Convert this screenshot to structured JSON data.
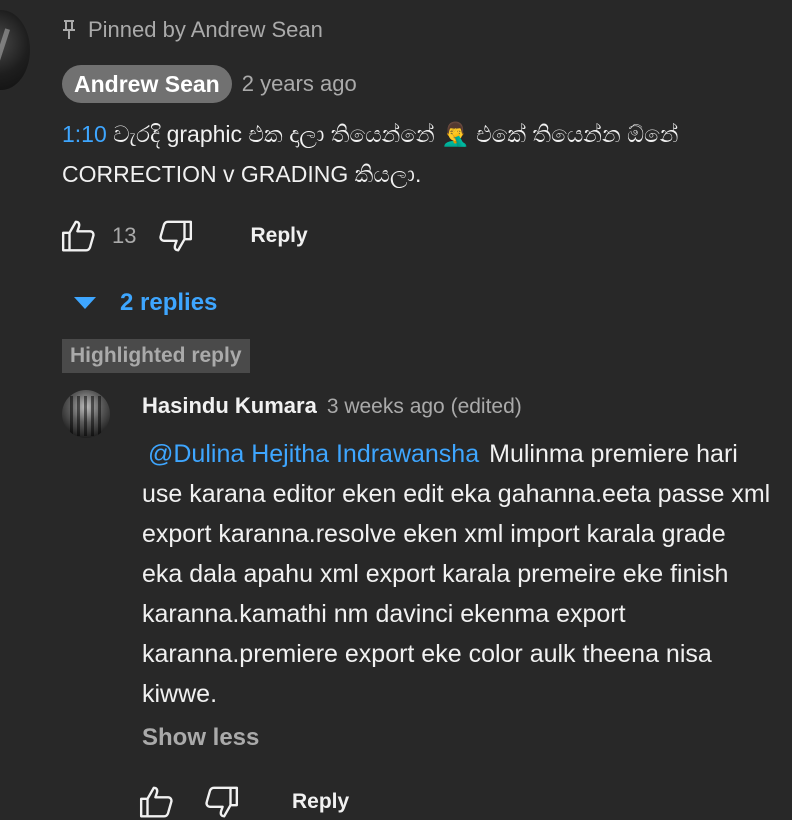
{
  "pinned": {
    "text": "Pinned by Andrew Sean",
    "icon": "pin-icon"
  },
  "comment": {
    "author": "Andrew Sean",
    "time": "2 years ago",
    "timestamp_link": "1:10",
    "text_rest": " වැරදි graphic එක දාලා තියෙන්නේ 🤦‍♂️ එකේ තියෙන්න ඕනේ CORRECTION v GRADING කියලා.",
    "likes": "13",
    "reply_label": "Reply"
  },
  "replies": {
    "toggle_label": "2 replies",
    "caret_icon": "caret-down-icon"
  },
  "highlight_badge": "Highlighted reply",
  "reply": {
    "author": "Hasindu Kumara",
    "time": "3 weeks ago (edited)",
    "mention": "@Dulina Hejitha Indrawansha",
    "text": "Mulinma premiere hari use karana editor eken edit eka gahanna.eeta passe xml export karanna.resolve eken xml import karala grade eka dala apahu xml export karala premeire eke finish karanna.kamathi nm davinci ekenma export karanna.premiere export eke color aulk theena nisa kiwwe.",
    "show_less_label": "Show less",
    "reply_label": "Reply"
  },
  "colors": {
    "background": "#282828",
    "link": "#3ea6ff",
    "muted": "#aaaaaa",
    "text": "#f1f1f1",
    "chip": "#717171"
  }
}
